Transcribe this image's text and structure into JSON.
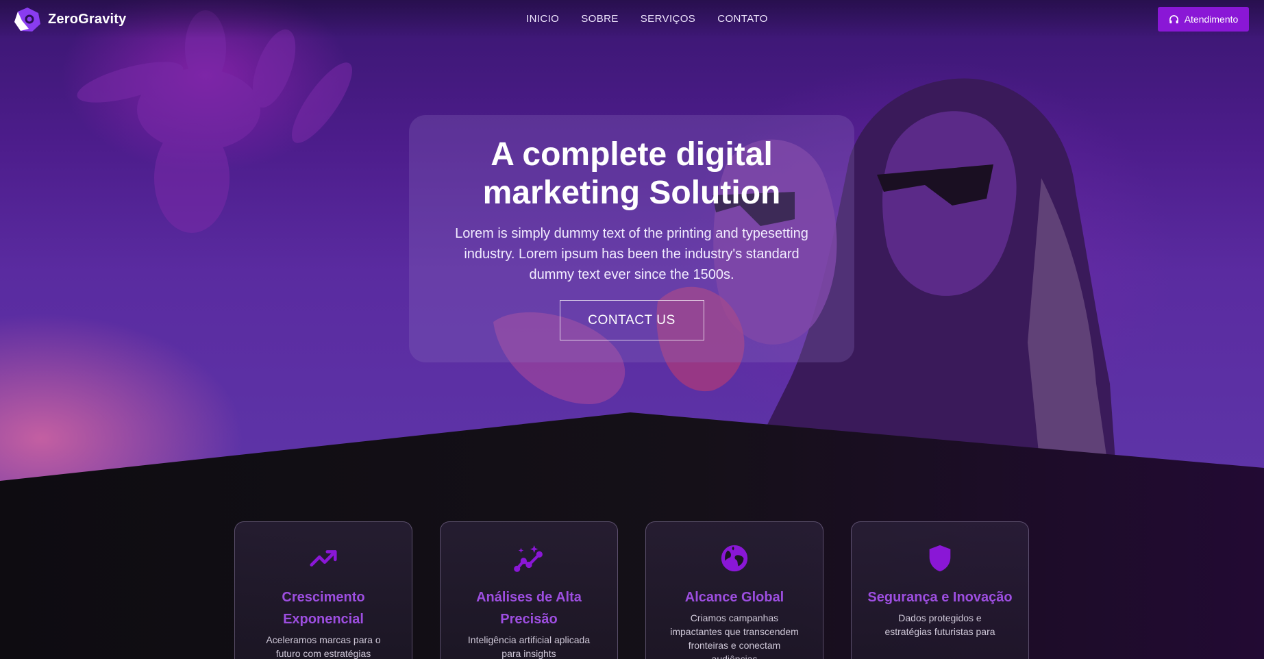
{
  "nav": {
    "brand": "ZeroGravity",
    "links": [
      "INICIO",
      "SOBRE",
      "SERVIÇOS",
      "CONTATO"
    ],
    "cta_label": "Atendimento"
  },
  "hero": {
    "title": "A complete digital marketing Solution",
    "subtitle": "Lorem is simply dummy text of the printing and typesetting industry. Lorem ipsum has been the industry's standard dummy text ever since the 1500s.",
    "button_label": "CONTACT US"
  },
  "features": [
    {
      "icon": "trending-up-icon",
      "title": "Crescimento Exponencial",
      "description": "Aceleramos marcas para o futuro com estratégias"
    },
    {
      "icon": "sparkle-chart-icon",
      "title": "Análises de Alta Precisão",
      "description": "Inteligência artificial aplicada para insights"
    },
    {
      "icon": "globe-icon",
      "title": "Alcance Global",
      "description": "Criamos campanhas impactantes que transcendem fronteiras e conectam audiências"
    },
    {
      "icon": "shield-icon",
      "title": "Segurança e Inovação",
      "description": "Dados protegidos e estratégias futuristas para"
    }
  ],
  "colors": {
    "accent": "#8a17d6",
    "feature_title": "#9d4ee0",
    "hero_top": "#3a1670",
    "dark_bg": "#0d0b10"
  }
}
